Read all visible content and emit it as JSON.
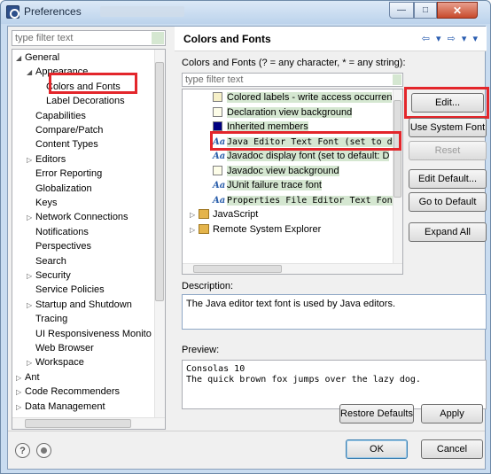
{
  "window": {
    "title": "Preferences",
    "controls": {
      "minimize": "—",
      "maximize": "□",
      "close": "✕"
    }
  },
  "left": {
    "filter_placeholder": "type filter text",
    "tree": [
      {
        "label": "General",
        "twisty": "◢",
        "indent": 0
      },
      {
        "label": "Appearance",
        "twisty": "◢",
        "indent": 1
      },
      {
        "label": "Colors and Fonts",
        "twisty": "",
        "indent": 2,
        "selected": true
      },
      {
        "label": "Label Decorations",
        "twisty": "",
        "indent": 2
      },
      {
        "label": "Capabilities",
        "twisty": "",
        "indent": 1
      },
      {
        "label": "Compare/Patch",
        "twisty": "",
        "indent": 1
      },
      {
        "label": "Content Types",
        "twisty": "",
        "indent": 1
      },
      {
        "label": "Editors",
        "twisty": "▷",
        "indent": 1
      },
      {
        "label": "Error Reporting",
        "twisty": "",
        "indent": 1
      },
      {
        "label": "Globalization",
        "twisty": "",
        "indent": 1
      },
      {
        "label": "Keys",
        "twisty": "",
        "indent": 1
      },
      {
        "label": "Network Connections",
        "twisty": "▷",
        "indent": 1
      },
      {
        "label": "Notifications",
        "twisty": "",
        "indent": 1
      },
      {
        "label": "Perspectives",
        "twisty": "",
        "indent": 1
      },
      {
        "label": "Search",
        "twisty": "",
        "indent": 1
      },
      {
        "label": "Security",
        "twisty": "▷",
        "indent": 1
      },
      {
        "label": "Service Policies",
        "twisty": "",
        "indent": 1
      },
      {
        "label": "Startup and Shutdown",
        "twisty": "▷",
        "indent": 1
      },
      {
        "label": "Tracing",
        "twisty": "",
        "indent": 1
      },
      {
        "label": "UI Responsiveness Monito",
        "twisty": "",
        "indent": 1
      },
      {
        "label": "Web Browser",
        "twisty": "",
        "indent": 1
      },
      {
        "label": "Workspace",
        "twisty": "▷",
        "indent": 1
      },
      {
        "label": "Ant",
        "twisty": "▷",
        "indent": 0
      },
      {
        "label": "Code Recommenders",
        "twisty": "▷",
        "indent": 0
      },
      {
        "label": "Data Management",
        "twisty": "▷",
        "indent": 0
      }
    ]
  },
  "right": {
    "title": "Colors and Fonts",
    "nav_arrows": "⇦ ▾ ⇨ ▾ ▾",
    "filter_label": "Colors and Fonts (? = any character, * = any string):",
    "filter_placeholder": "type filter text",
    "items": [
      {
        "label": "Colored labels - write access occurren",
        "kind": "swatch",
        "color": "#f6f0c8"
      },
      {
        "label": "Declaration view background",
        "kind": "swatch",
        "color": "#fdfde8"
      },
      {
        "label": "Inherited members",
        "kind": "swatch",
        "color": "#000080"
      },
      {
        "label": "Java Editor Text Font (set to d",
        "kind": "font",
        "mono": true
      },
      {
        "label": "Javadoc display font (set to default: D",
        "kind": "font"
      },
      {
        "label": "Javadoc view background",
        "kind": "swatch",
        "color": "#fdfde8"
      },
      {
        "label": "JUnit failure trace font",
        "kind": "font"
      },
      {
        "label": "Properties File Editor Text Font",
        "kind": "font",
        "mono": true
      },
      {
        "label": "JavaScript",
        "kind": "group"
      },
      {
        "label": "Remote System Explorer",
        "kind": "group"
      }
    ],
    "buttons": {
      "edit": "Edit...",
      "use_system_font": "Use System Font",
      "reset": "Reset",
      "edit_default": "Edit Default...",
      "go_to_default": "Go to Default",
      "expand_all": "Expand All"
    },
    "description_label": "Description:",
    "description_text": "The Java editor text font is used by Java editors.",
    "preview_label": "Preview:",
    "preview_line1": "Consolas 10",
    "preview_line2": "The quick brown fox jumps over the lazy dog.",
    "restore_defaults": "Restore Defaults",
    "apply": "Apply"
  },
  "footer": {
    "help_icon": "?",
    "ok": "OK",
    "cancel": "Cancel"
  },
  "colors": {
    "highlight": "#e3262b",
    "selection_green": "#d5e7d1"
  }
}
